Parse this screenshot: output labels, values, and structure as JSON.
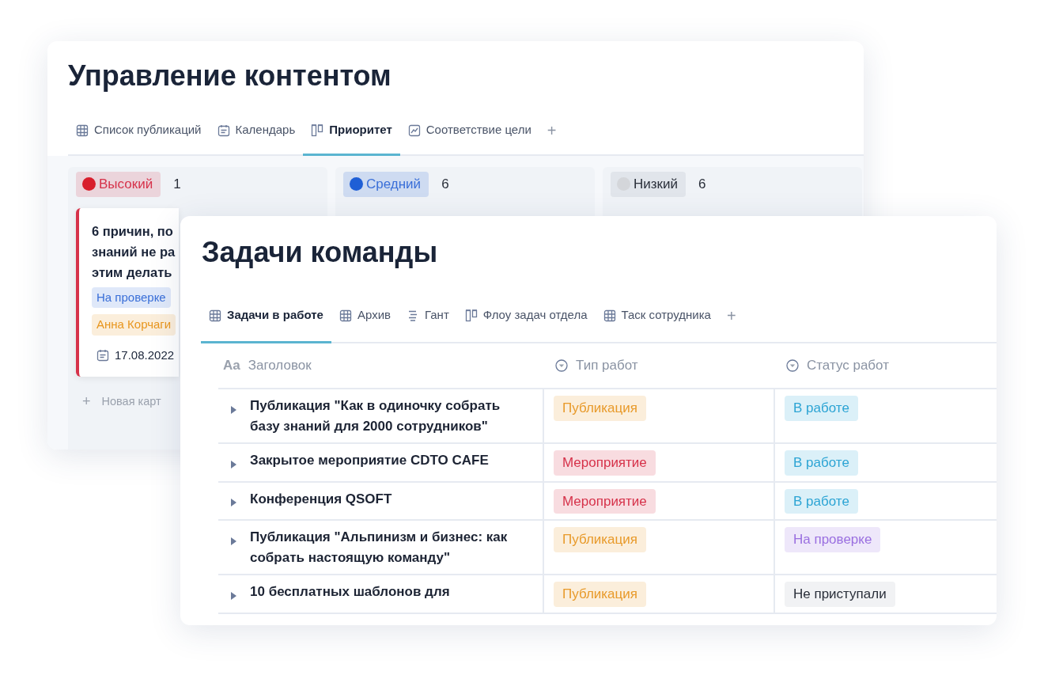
{
  "back_window": {
    "title": "Управление контентом",
    "tabs": [
      {
        "label": "Список публикаций",
        "kind": "table",
        "selected": false
      },
      {
        "label": "Календарь",
        "kind": "calendar",
        "selected": false
      },
      {
        "label": "Приоритет",
        "kind": "board",
        "selected": true
      },
      {
        "label": "Соответствие цели",
        "kind": "chart",
        "selected": false
      }
    ],
    "add_tab": "+",
    "columns": [
      {
        "label": "Высокий",
        "kind": "high",
        "color": "#d81e2c",
        "count": "1",
        "cards": [
          {
            "title": "6 причин, по\nзнаний не ра\nэтим делать",
            "tags": [
              {
                "text": "На проверке",
                "color": "#3a6fd8"
              },
              {
                "text": "Анна Корчаги",
                "color": "#e8961e"
              }
            ],
            "date": "17.08.2022"
          }
        ],
        "new_card": {
          "icon": "+",
          "label": "Новая карт"
        }
      },
      {
        "label": "Средний",
        "kind": "medium",
        "color": "#1f5fd6",
        "count": "6"
      },
      {
        "label": "Низкий",
        "kind": "low",
        "color": "#d4d6da",
        "count": "6"
      }
    ]
  },
  "front_window": {
    "title": "Задачи команды",
    "tabs": [
      {
        "label": "Задачи в работе",
        "kind": "table",
        "selected": true
      },
      {
        "label": "Архив",
        "kind": "table",
        "selected": false
      },
      {
        "label": "Гант",
        "kind": "gantt",
        "selected": false
      },
      {
        "label": "Флоу задач отдела",
        "kind": "board",
        "selected": false
      },
      {
        "label": "Таск сотрудника",
        "kind": "table",
        "selected": false
      }
    ],
    "add_tab": "+",
    "table": {
      "columns": [
        {
          "label": "Заголовок",
          "kind": "text",
          "icon_text": "Aa"
        },
        {
          "label": "Тип работ",
          "kind": "select"
        },
        {
          "label": "Статус работ",
          "kind": "select"
        }
      ],
      "rows": [
        {
          "title": "Публикация \"Как в одиночку собрать базу знаний для 2000 сотрудников\"",
          "type": {
            "text": "Публикация",
            "color": "#e89a2a"
          },
          "status": {
            "text": "В работе",
            "color": "#2ca4d4"
          }
        },
        {
          "title": "Закрытое мероприятие CDTO CAFE",
          "type": {
            "text": "Мероприятие",
            "color": "#d6324a"
          },
          "status": {
            "text": "В работе",
            "color": "#2ca4d4"
          }
        },
        {
          "title": "Конференция QSOFT",
          "type": {
            "text": "Мероприятие",
            "color": "#d6324a"
          },
          "status": {
            "text": "В работе",
            "color": "#2ca4d4"
          }
        },
        {
          "title": "Публикация \"Альпинизм и бизнес: как собрать настоящую команду\"",
          "type": {
            "text": "Публикация",
            "color": "#e89a2a"
          },
          "status": {
            "text": "На проверке",
            "color": "#9a6fe0"
          }
        },
        {
          "title": "10 бесплатных шаблонов для",
          "type": {
            "text": "Публикация",
            "color": "#e89a2a"
          },
          "status": {
            "text": "Не приступали",
            "color": "#2a2f3a"
          }
        }
      ]
    }
  }
}
